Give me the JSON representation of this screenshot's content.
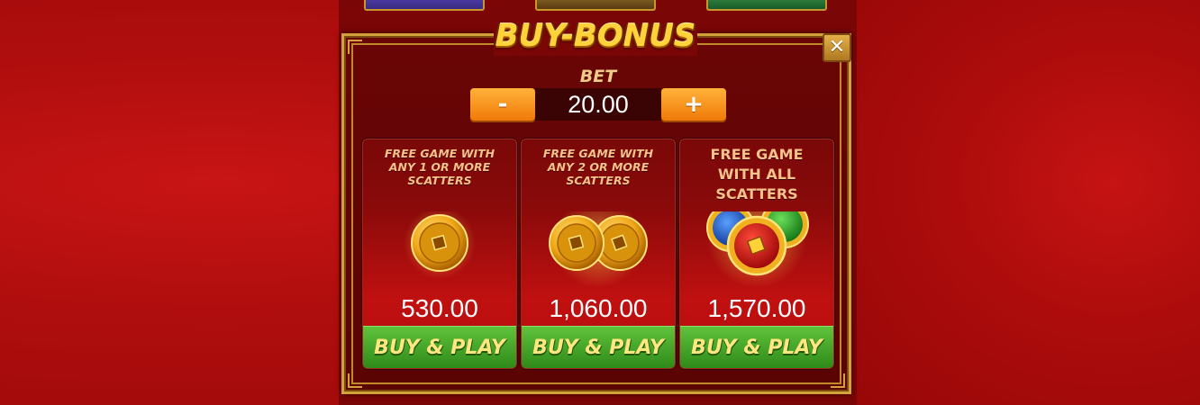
{
  "title": "BUY-BONUS",
  "close_icon": "close-icon",
  "bet": {
    "label": "BET",
    "value": "20.00",
    "minus_label": "-",
    "plus_label": "+"
  },
  "options": [
    {
      "description": "FREE GAME WITH ANY 1 OR MORE SCATTERS",
      "price": "530.00",
      "button": "BUY & PLAY",
      "coins": "1-gold-coin"
    },
    {
      "description": "FREE GAME WITH ANY 2 OR MORE SCATTERS",
      "price": "1,060.00",
      "button": "BUY & PLAY",
      "coins": "2-gold-coins"
    },
    {
      "description": "FREE GAME WITH ALL SCATTERS",
      "price": "1,570.00",
      "button": "BUY & PLAY",
      "coins": "blue-red-green-coins"
    }
  ],
  "colors": {
    "accent_gold": "#d4a23a",
    "title_yellow": "#ffd23a",
    "bet_button_orange": "#f07a08",
    "buy_button_green": "#3fa022",
    "background_red": "#b00c0c"
  }
}
